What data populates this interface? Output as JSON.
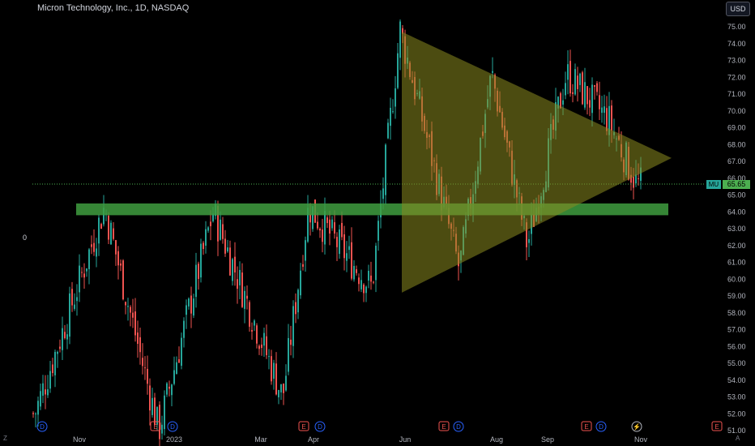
{
  "header": {
    "title": "Micron Technology, Inc., 1D, NASDAQ",
    "currency_button": "USD"
  },
  "left_axis_label": "0",
  "price_line": {
    "ticker": "MU",
    "price": "65.65"
  },
  "bottom_controls": {
    "zoom_button": "Z",
    "auto_button": "A"
  },
  "colors": {
    "up": "#26a69a",
    "down": "#ef5350",
    "green_zone": "#3f9e3f",
    "triangle_fill": "#8b8b1f"
  },
  "chart_data": {
    "type": "candlestick",
    "title": "Micron Technology, Inc., 1D, NASDAQ",
    "y_axis": {
      "side": "right",
      "ticks": [
        "75.00",
        "74.00",
        "73.00",
        "72.00",
        "71.00",
        "70.00",
        "69.00",
        "68.00",
        "67.00",
        "66.00",
        "65.00",
        "64.00",
        "63.00",
        "62.00",
        "61.00",
        "60.00",
        "59.00",
        "58.00",
        "57.00",
        "56.00",
        "55.00",
        "54.00",
        "53.00",
        "52.00",
        "51.00"
      ],
      "range": [
        51,
        75.5
      ]
    },
    "x_axis": {
      "ticks": [
        "Nov",
        "2023",
        "Mar",
        "Apr",
        "Jun",
        "Aug",
        "Sep",
        "Nov"
      ]
    },
    "last_price": 65.65,
    "key_points": [
      {
        "label": "Nov",
        "close": 52.0
      },
      {
        "label": "Dec high",
        "close": 64.3
      },
      {
        "label": "2023 low",
        "close": 51.0
      },
      {
        "label": "Feb high",
        "close": 64.0
      },
      {
        "label": "Mar low",
        "close": 53.0
      },
      {
        "label": "Apr high",
        "close": 64.3
      },
      {
        "label": "May low",
        "close": 59.5
      },
      {
        "label": "Jun high",
        "close": 74.8
      },
      {
        "label": "Jul low",
        "close": 60.6
      },
      {
        "label": "Aug high",
        "close": 72.2
      },
      {
        "label": "Sep low",
        "close": 62.0
      },
      {
        "label": "Sep high",
        "close": 72.2
      },
      {
        "label": "Oct",
        "close": 69.5
      },
      {
        "label": "Nov",
        "close": 65.65
      }
    ],
    "annotations": {
      "support_zone": {
        "from": 63.8,
        "to": 64.5,
        "color": "green"
      },
      "triangle": {
        "apex_price": 67.2,
        "top_price": 74.7,
        "bottom_price": 59.2
      }
    },
    "event_markers": [
      {
        "type": "D",
        "at": "Oct"
      },
      {
        "type": "E",
        "at": "Dec"
      },
      {
        "type": "D",
        "at": "Dec"
      },
      {
        "type": "E",
        "at": "Mar"
      },
      {
        "type": "D",
        "at": "Mar"
      },
      {
        "type": "E",
        "at": "Jun"
      },
      {
        "type": "D",
        "at": "Jun"
      },
      {
        "type": "E",
        "at": "Sep"
      },
      {
        "type": "D",
        "at": "Sep"
      },
      {
        "type": "split",
        "at": "Oct"
      },
      {
        "type": "E",
        "at": "Dec-future"
      }
    ]
  }
}
